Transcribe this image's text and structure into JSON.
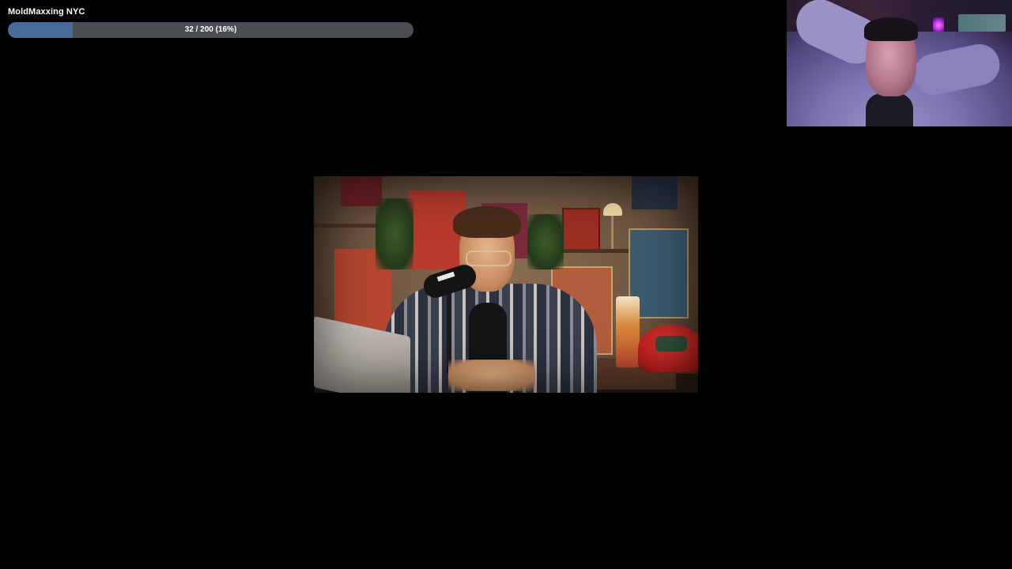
{
  "goal": {
    "title": "MoldMaxxing NYC",
    "current": 32,
    "target": 200,
    "fraction": 0.16,
    "label": "32 / 200 (16%)",
    "fill_color": "#466b9b",
    "track_color": "#4a4d52"
  },
  "colors": {
    "background": "#000000",
    "text": "#ffffff"
  }
}
